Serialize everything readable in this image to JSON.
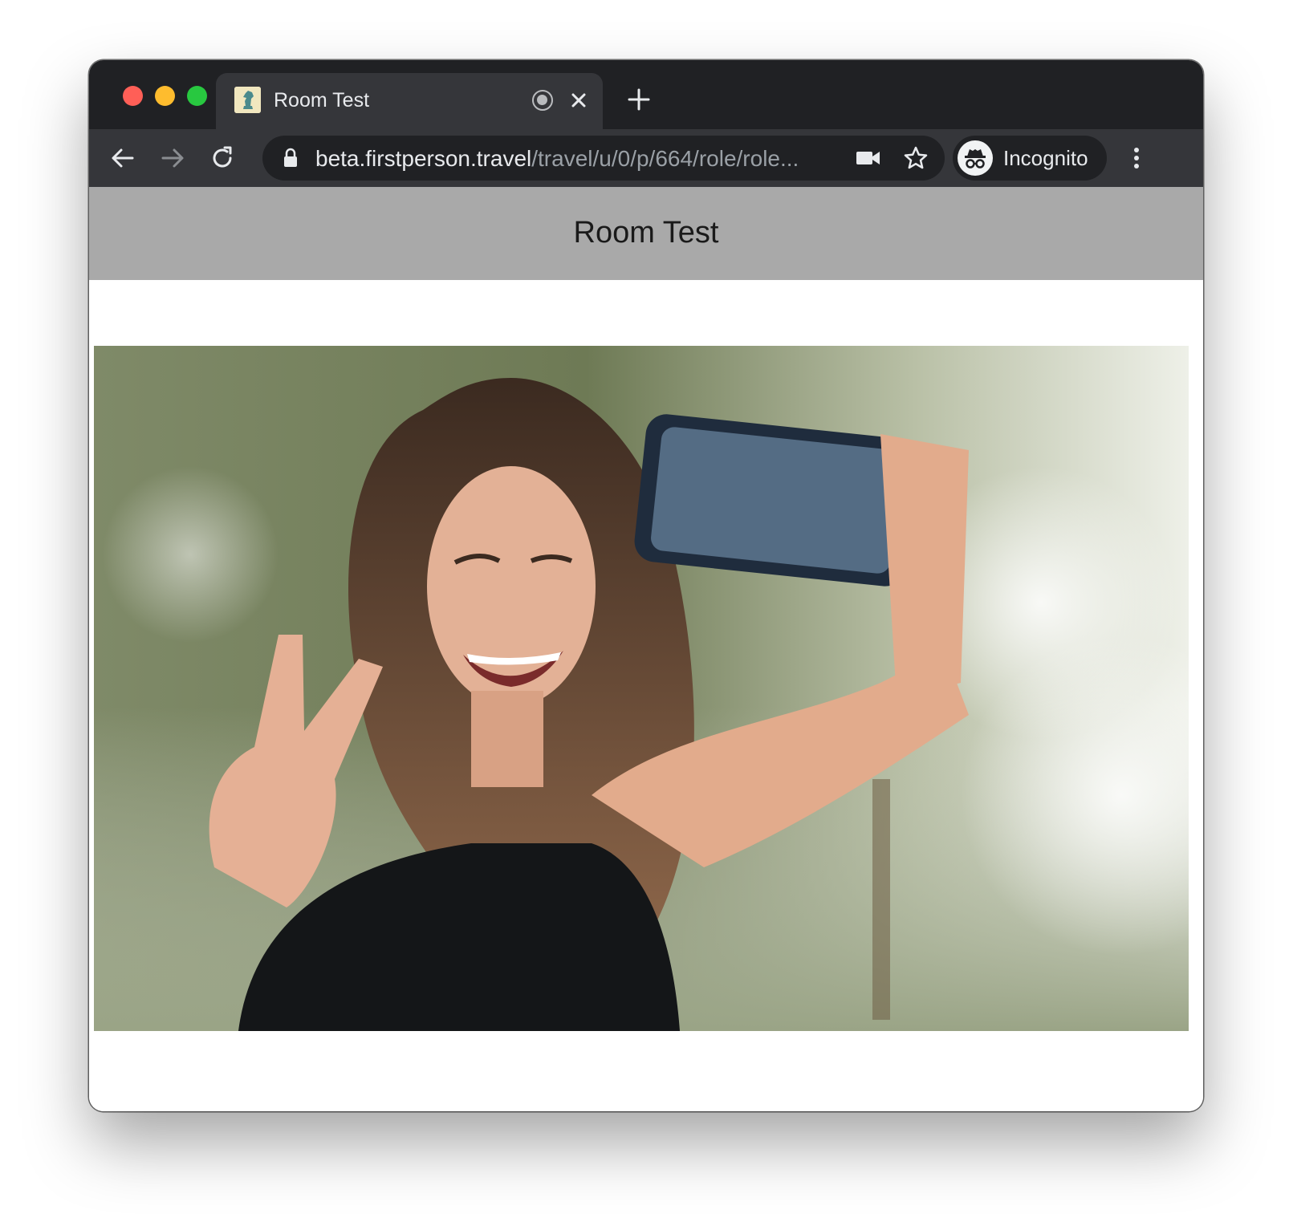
{
  "browser": {
    "tab": {
      "title": "Room Test",
      "favicon_icon": "chess-knight-icon",
      "recording_icon": "recording-indicator-icon",
      "close_icon": "close-icon"
    },
    "new_tab_icon": "plus-icon",
    "nav": {
      "back_icon": "arrow-left-icon",
      "forward_icon": "arrow-right-icon",
      "reload_icon": "reload-icon"
    },
    "address": {
      "lock_icon": "lock-icon",
      "host": "beta.firstperson.travel",
      "path": "/travel/u/0/p/664/role/role...",
      "camera_icon": "video-camera-icon",
      "bookmark_icon": "star-icon"
    },
    "profile": {
      "label": "Incognito",
      "icon": "incognito-icon"
    },
    "menu_icon": "kebab-menu-icon"
  },
  "page": {
    "title": "Room Test",
    "photo": {
      "subject": "woman taking a selfie with a smartphone, peace sign, outdoor bokeh background"
    }
  },
  "colors": {
    "tabstrip": "#202124",
    "toolbar": "#35363a",
    "header_bar": "#a9a9a9",
    "traffic_red": "#ff5f57",
    "traffic_yellow": "#febc2e",
    "traffic_green": "#28c840"
  }
}
